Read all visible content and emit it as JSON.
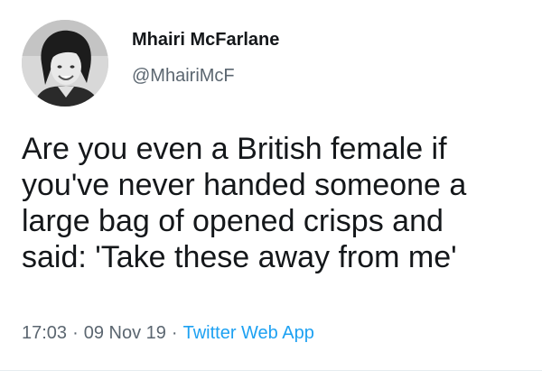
{
  "author": {
    "display_name": "Mhairi McFarlane",
    "handle": "@MhairiMcF"
  },
  "tweet": {
    "text": "Are you even a British female if\nyou've never handed someone a\nlarge bag of opened crisps and\nsaid: 'Take these away from me'"
  },
  "meta": {
    "time": "17:03",
    "separator": "·",
    "date": "09 Nov 19",
    "source": "Twitter Web App"
  },
  "colors": {
    "text": "#14171a",
    "secondary_text": "#5b6670",
    "link": "#1da1f2"
  },
  "icons": {
    "avatar": "profile-photo"
  }
}
